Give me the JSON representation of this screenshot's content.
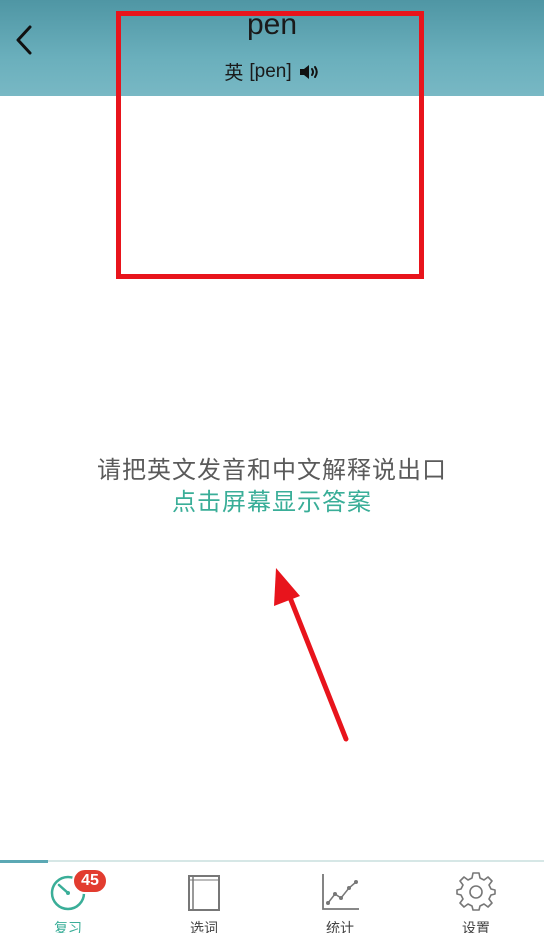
{
  "header": {
    "word": "pen",
    "phonetic_lang": "英",
    "phonetic": "[pen]"
  },
  "main": {
    "prompt": "请把英文发音和中文解释说出口",
    "hint": "点击屏幕显示答案"
  },
  "tabbar": {
    "tabs": [
      {
        "label": "复习",
        "icon": "review-timer-icon",
        "active": true,
        "badge": "45"
      },
      {
        "label": "选词",
        "icon": "book-icon",
        "active": false
      },
      {
        "label": "统计",
        "icon": "line-chart-icon",
        "active": false
      },
      {
        "label": "设置",
        "icon": "gear-icon",
        "active": false
      }
    ]
  },
  "colors": {
    "header": "#5fa6b2",
    "accent": "#3aae98",
    "badge": "#e23c2f",
    "annotation": "#e8141c"
  }
}
